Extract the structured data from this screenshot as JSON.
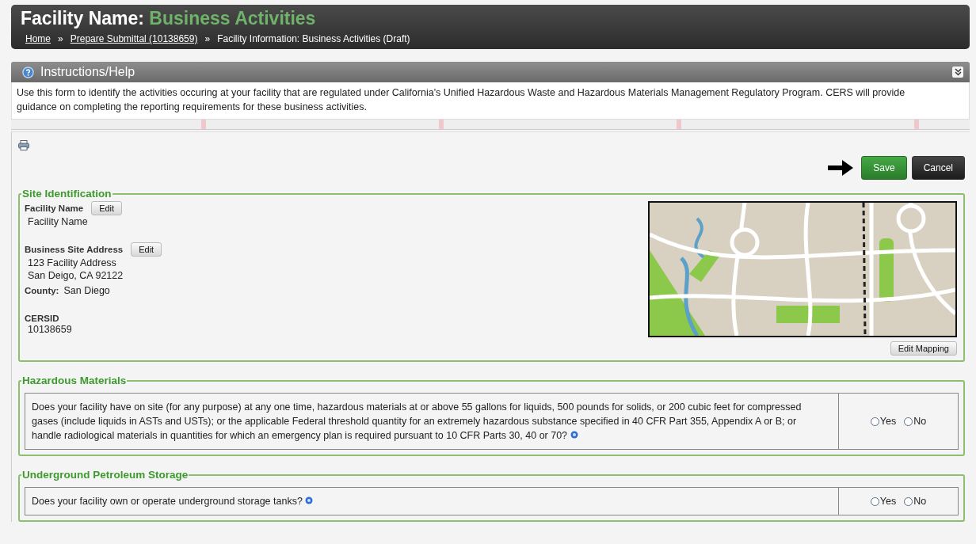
{
  "header": {
    "title_prefix": "Facility Name:",
    "title_highlight": "Business Activities",
    "breadcrumbs": [
      {
        "label": "Home",
        "link": true,
        "separator": "»"
      },
      {
        "label": "Prepare Submittal (10138659)",
        "link": true,
        "separator": "»"
      },
      {
        "label": "Facility Information: Business Activities (Draft)",
        "link": false
      }
    ]
  },
  "help": {
    "title": "Instructions/Help",
    "expanded": true,
    "text": "Use this form to identify the activities occuring at your facility that are regulated under California's Unified Hazardous Waste and Hazardous Materials Management Regulatory Program. CERS will provide guidance on completing the reporting requirements for these business activities."
  },
  "actions": [
    {
      "label": "Save",
      "kind": "primary"
    },
    {
      "label": "Cancel",
      "kind": "secondary"
    }
  ],
  "site": {
    "legend": "Site Identification",
    "edit_mapping": "Edit Mapping",
    "fields": [
      {
        "kind": "block",
        "label": "Facility Name",
        "edit": "Edit",
        "lines": [
          "Facility Name"
        ]
      },
      {
        "kind": "block",
        "label": "Business Site Address",
        "edit": "Edit",
        "lines": [
          "123 Facility Address",
          "San Deigo, CA  92122"
        ]
      },
      {
        "kind": "inline",
        "label": "County:",
        "lines": [
          "San Diego"
        ]
      },
      {
        "kind": "block",
        "label": "CERSID",
        "lines": [
          "10138659"
        ]
      }
    ]
  },
  "questions": [
    {
      "legend": "Hazardous Materials",
      "question": "Does your facility have on site (for any purpose) at any one time, hazardous materials at or above 55 gallons for liquids, 500 pounds for solids, or 200 cubic feet for compressed gases (include liquids in ASTs and USTs); or the applicable Federal threshold quantity for an extremely hazardous substance specified in 40 CFR Part 355, Appendix A or B; or handle radiological materials in quantities for which an emergency plan is required pursuant to 10 CFR Parts 30, 40 or 70?",
      "options": [
        {
          "label": "Yes",
          "selected": false
        },
        {
          "label": "No",
          "selected": false
        }
      ]
    },
    {
      "legend": "Underground Petroleum Storage",
      "question": "Does your facility own or operate underground storage tanks?",
      "options": [
        {
          "label": "Yes",
          "selected": false
        },
        {
          "label": "No",
          "selected": false
        }
      ]
    }
  ]
}
